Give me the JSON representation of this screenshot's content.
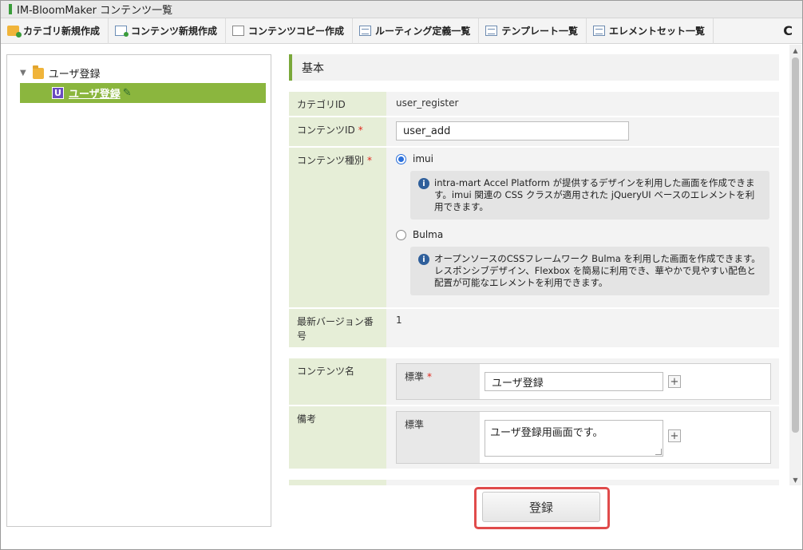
{
  "window": {
    "title": "IM-BloomMaker コンテンツ一覧"
  },
  "toolbar": {
    "items": [
      {
        "label": "カテゴリ新規作成",
        "icon": "folder-add-icon"
      },
      {
        "label": "コンテンツ新規作成",
        "icon": "document-add-icon"
      },
      {
        "label": "コンテンツコピー作成",
        "icon": "copy-icon"
      },
      {
        "label": "ルーティング定義一覧",
        "icon": "list-icon"
      },
      {
        "label": "テンプレート一覧",
        "icon": "list-icon"
      },
      {
        "label": "エレメントセット一覧",
        "icon": "list-icon"
      }
    ],
    "refresh_label": "C"
  },
  "tree": {
    "root_label": "ユーザ登録",
    "node_label": "ユーザ登録",
    "node_badge": "U"
  },
  "form": {
    "section_title": "基本",
    "category_id_label": "カテゴリID",
    "category_id_value": "user_register",
    "content_id_label": "コンテンツID",
    "content_id_value": "user_add",
    "content_type_label": "コンテンツ種別",
    "required_mark": "*",
    "type_options": [
      {
        "label": "imui",
        "selected": true,
        "info": "intra-mart Accel Platform が提供するデザインを利用した画面を作成できます。imui 関連の CSS クラスが適用された jQueryUI ベースのエレメントを利用できます。"
      },
      {
        "label": "Bulma",
        "selected": false,
        "info": "オープンソースのCSSフレームワーク Bulma を利用した画面を作成できます。レスポンシブデザイン、Flexbox を簡易に利用でき、華やかで見やすい配色と配置が可能なエレメントを利用できます。"
      }
    ],
    "info_icon": "i",
    "version_label": "最新バージョン番号",
    "version_value": "1",
    "content_name_label": "コンテンツ名",
    "content_name_lang": "標準",
    "content_name_value": "ユーザ登録",
    "remarks_label": "備考",
    "remarks_lang": "標準",
    "remarks_value": "ユーザ登録用画面です。",
    "plus_label": "+"
  },
  "actions": {
    "register_label": "登録"
  },
  "colors": {
    "accent": "#8bb63e",
    "label_bg": "#e6eed7",
    "highlight": "#e04b4b"
  }
}
